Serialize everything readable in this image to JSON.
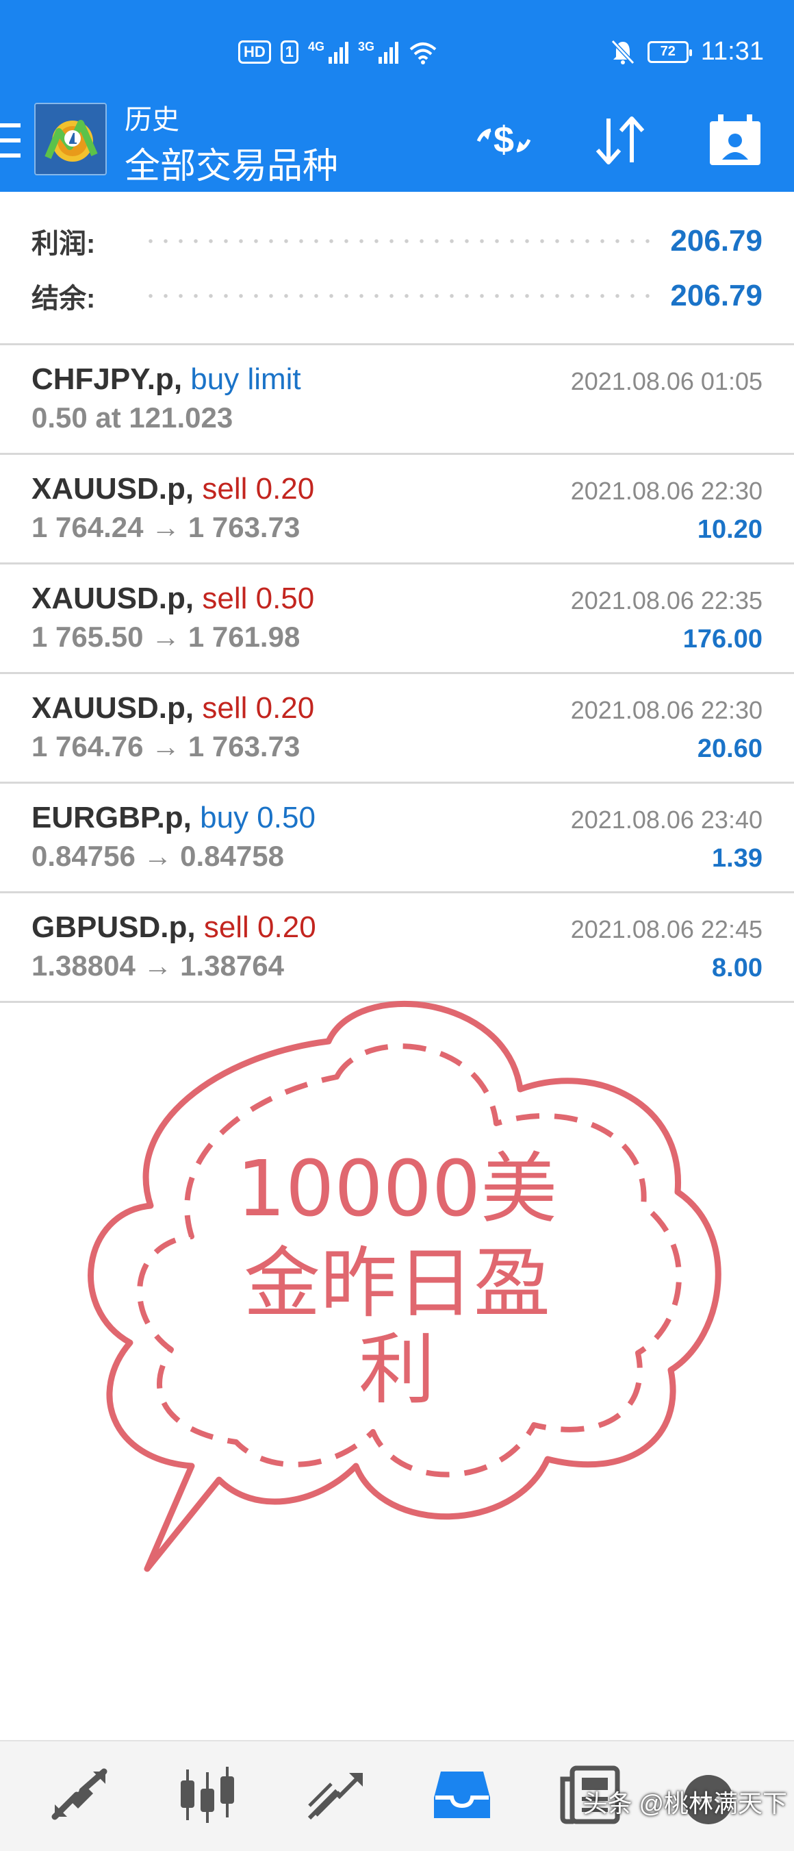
{
  "status_bar": {
    "hd_label": "HD",
    "sim_label": "1",
    "network_1": "4G",
    "network_2": "3G",
    "battery": "72",
    "time": "11:31"
  },
  "header": {
    "subtitle": "历史",
    "title": "全部交易品种"
  },
  "summary": {
    "profit_label": "利润:",
    "profit_value": "206.79",
    "balance_label": "结余:",
    "balance_value": "206.79"
  },
  "trades": [
    {
      "symbol": "CHFJPY.p,",
      "action": "buy limit",
      "action_type": "buy",
      "prices": "0.50 at 121.023",
      "time": "2021.08.06 01:05",
      "profit": ""
    },
    {
      "symbol": "XAUUSD.p,",
      "action": "sell 0.20",
      "action_type": "sell",
      "prices": "1 764.24 → 1 763.73",
      "time": "2021.08.06 22:30",
      "profit": "10.20"
    },
    {
      "symbol": "XAUUSD.p,",
      "action": "sell 0.50",
      "action_type": "sell",
      "prices": "1 765.50 → 1 761.98",
      "time": "2021.08.06 22:35",
      "profit": "176.00"
    },
    {
      "symbol": "XAUUSD.p,",
      "action": "sell 0.20",
      "action_type": "sell",
      "prices": "1 764.76 → 1 763.73",
      "time": "2021.08.06 22:30",
      "profit": "20.60"
    },
    {
      "symbol": "EURGBP.p,",
      "action": "buy 0.50",
      "action_type": "buy",
      "prices": "0.84756 → 0.84758",
      "time": "2021.08.06 23:40",
      "profit": "1.39"
    },
    {
      "symbol": "GBPUSD.p,",
      "action": "sell 0.20",
      "action_type": "sell",
      "prices": "1.38804 → 1.38764",
      "time": "2021.08.06 22:45",
      "profit": "8.00"
    }
  ],
  "overlay": {
    "line1": "10000美",
    "line2": "金昨日盈",
    "line3": "利",
    "color": "#e0676f"
  },
  "bottom_nav": {
    "items": [
      "quotes-icon",
      "chart-icon",
      "trade-icon",
      "history-icon",
      "news-icon",
      "chat-icon"
    ],
    "active": "history-icon"
  },
  "watermark": "头条 @桃林满天下",
  "colors": {
    "header_bg": "#1a84f0",
    "accent_blue": "#1a73c8",
    "sell_red": "#c3251f"
  }
}
